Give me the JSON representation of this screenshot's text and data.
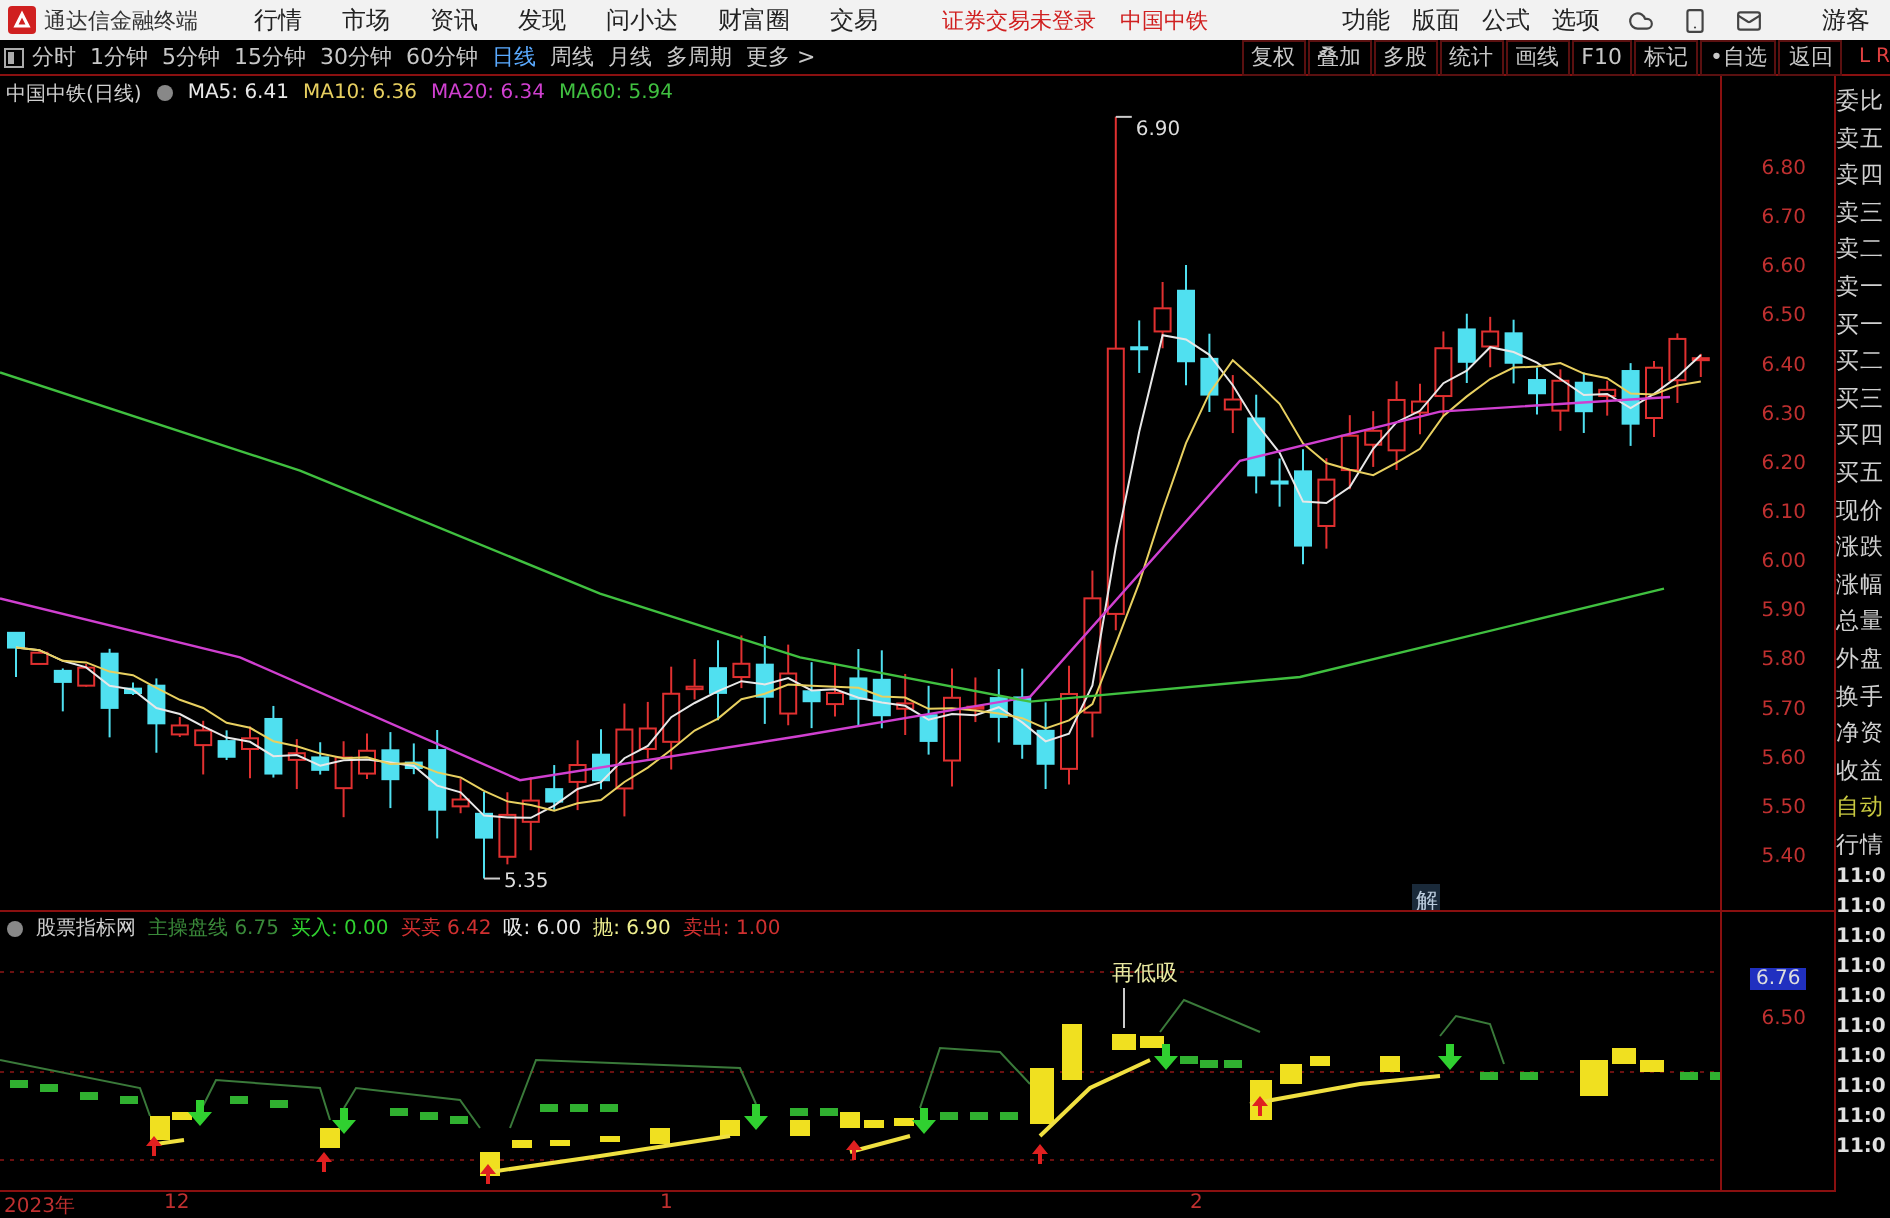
{
  "top_bar": {
    "app_title": "通达信金融终端",
    "menu": [
      "行情",
      "市场",
      "资讯",
      "发现",
      "问小达",
      "财富圈",
      "交易"
    ],
    "status": [
      "证券交易未登录",
      "中国中铁"
    ],
    "tools": [
      "功能",
      "版面",
      "公式",
      "选项"
    ],
    "user": "游客"
  },
  "period_bar": {
    "periods": [
      {
        "label": "分时",
        "selected": false
      },
      {
        "label": "1分钟",
        "selected": false
      },
      {
        "label": "5分钟",
        "selected": false
      },
      {
        "label": "15分钟",
        "selected": false
      },
      {
        "label": "30分钟",
        "selected": false
      },
      {
        "label": "60分钟",
        "selected": false
      },
      {
        "label": "日线",
        "selected": true
      },
      {
        "label": "周线",
        "selected": false
      },
      {
        "label": "月线",
        "selected": false
      },
      {
        "label": "多周期",
        "selected": false
      },
      {
        "label": "更多 >",
        "selected": false
      }
    ],
    "actions": [
      "复权",
      "叠加",
      "多股",
      "统计",
      "画线",
      "F10",
      "标记",
      "•自选",
      "返回"
    ],
    "corner": [
      "L",
      "R"
    ]
  },
  "main_chart": {
    "title": "中国中铁(日线)",
    "ma": [
      {
        "label": "MA5: 6.41",
        "color": "#e8e8e8"
      },
      {
        "label": "MA10: 6.36",
        "color": "#e8d060"
      },
      {
        "label": "MA20: 6.34",
        "color": "#d040d0"
      },
      {
        "label": "MA60: 5.94",
        "color": "#40c040"
      }
    ],
    "y_axis": [
      "6.80",
      "6.70",
      "6.60",
      "6.50",
      "6.40",
      "6.30",
      "6.20",
      "6.10",
      "6.00",
      "5.90",
      "5.80",
      "5.70",
      "5.60",
      "5.50",
      "5.40"
    ],
    "high_label": "6.90",
    "low_label": "5.35",
    "marker": "解"
  },
  "indicator": {
    "name": "股票指标网",
    "values": [
      {
        "label": "主操盘线",
        "value": "6.75",
        "color": "#3a8a3a"
      },
      {
        "label": "买入:",
        "value": "0.00",
        "color": "#30d030"
      },
      {
        "label": "买卖",
        "value": "6.42",
        "color": "#d03030"
      },
      {
        "label": "吸:",
        "value": "6.00",
        "color": "#e8e8e8"
      },
      {
        "label": "抛:",
        "value": "6.90",
        "color": "#f0f090"
      },
      {
        "label": "卖出:",
        "value": "1.00",
        "color": "#d03030"
      }
    ],
    "signal_label": "再低吸",
    "current_value": "6.76",
    "y_axis": [
      "6.50"
    ]
  },
  "date_axis": [
    "2023年",
    "12",
    "1",
    "2"
  ],
  "quote_panel": {
    "fields": [
      {
        "label": "委比",
        "highlighted": false
      },
      {
        "label": "卖五",
        "highlighted": false
      },
      {
        "label": "卖四",
        "highlighted": false
      },
      {
        "label": "卖三",
        "highlighted": false
      },
      {
        "label": "卖二",
        "highlighted": false
      },
      {
        "label": "卖一",
        "highlighted": false
      },
      {
        "label": "买一",
        "highlighted": false
      },
      {
        "label": "买二",
        "highlighted": false
      },
      {
        "label": "买三",
        "highlighted": false
      },
      {
        "label": "买四",
        "highlighted": false
      },
      {
        "label": "买五",
        "highlighted": false
      },
      {
        "label": "现价",
        "highlighted": false
      },
      {
        "label": "涨跌",
        "highlighted": false
      },
      {
        "label": "涨幅",
        "highlighted": false
      },
      {
        "label": "总量",
        "highlighted": false
      },
      {
        "label": "外盘",
        "highlighted": false
      },
      {
        "label": "换手",
        "highlighted": false
      },
      {
        "label": "净资",
        "highlighted": false
      },
      {
        "label": "收益",
        "highlighted": false
      },
      {
        "label": "自动",
        "highlighted": true
      },
      {
        "label": "行情",
        "highlighted": false
      }
    ],
    "times": [
      "11:0",
      "11:0",
      "11:0",
      "11:0",
      "11:0",
      "11:0",
      "11:0",
      "11:0",
      "11:0",
      "11:0"
    ]
  }
}
